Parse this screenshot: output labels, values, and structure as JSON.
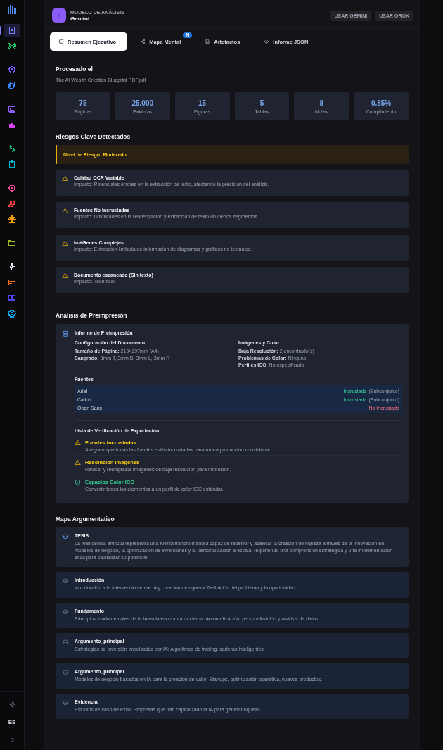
{
  "sidebar": {
    "items": [
      {
        "kind": "document",
        "color": "#7c83ff",
        "selected": true
      },
      {
        "kind": "signal",
        "color": "#22c55e",
        "selected": false
      },
      {
        "kind": "shield",
        "color": "#7c5cff",
        "selected": false
      },
      {
        "kind": "copy",
        "color": "#3b82f6",
        "selected": false
      },
      {
        "kind": "terminal",
        "color": "#8b5cf6",
        "selected": false
      },
      {
        "kind": "bars",
        "color": "#d946ef",
        "selected": false
      },
      {
        "kind": "translate",
        "color": "#10b981",
        "selected": false
      },
      {
        "kind": "clipboard",
        "color": "#06b6d4",
        "selected": false
      },
      {
        "kind": "cap",
        "color": "#ec4899",
        "selected": false
      },
      {
        "kind": "users",
        "color": "#ef4444",
        "selected": false
      },
      {
        "kind": "scales",
        "color": "#f59e0b",
        "selected": false
      },
      {
        "kind": "folder",
        "color": "#a3b818",
        "selected": false
      },
      {
        "kind": "person",
        "color": "#e5e7eb",
        "selected": false
      },
      {
        "kind": "card",
        "color": "#f97316",
        "selected": false
      },
      {
        "kind": "book",
        "color": "#4f46e5",
        "selected": false
      },
      {
        "kind": "gear",
        "color": "#0ea5e9",
        "selected": false
      }
    ],
    "language": "ES"
  },
  "header": {
    "caption": "MODELO DE ANÁLISIS",
    "model": "Gemini",
    "buttons": [
      "USAR GEMINI",
      "USAR GROK"
    ]
  },
  "tabs": [
    {
      "label": "Resumen Ejecutivo",
      "selected": true
    },
    {
      "label": "Mapa Mental",
      "badge": "N",
      "selected": false
    },
    {
      "label": "Artefactos",
      "selected": false
    },
    {
      "label": "Informe JSON",
      "selected": false
    }
  ],
  "processed": {
    "title": "Procesado el",
    "file": "The AI Wealth Creation Blueprint PDF.pdf"
  },
  "stats": [
    {
      "value": "75",
      "label": "Páginas"
    },
    {
      "value": "25.000",
      "label": "Palabras"
    },
    {
      "value": "15",
      "label": "Figuras"
    },
    {
      "value": "5",
      "label": "Tablas"
    },
    {
      "value": "8",
      "label": "Notas"
    },
    {
      "value": "0.85%",
      "label": "Cumplimiento"
    }
  ],
  "risks": {
    "title": "Riesgos Clave Detectados",
    "level": "Nivel de Riesgo: Moderado",
    "items": [
      {
        "title": "Calidad OCR Variable",
        "impact": "**Impacto:** Potenciales errores en la extracción de texto, afectando la precisión del análisis."
      },
      {
        "title": "Fuentes No Incrustadas",
        "impact": "**Impacto:** Dificultades en la renderización y extracción de texto en ciertos segmentos."
      },
      {
        "title": "ImáGenes Complejas",
        "impact": "**Impacto:** Extracción limitada de información de diagramas y gráficos no textuales."
      },
      {
        "title": "Documento escaneado (Sin texto)",
        "impact": "**Impacto:** Technical"
      }
    ]
  },
  "preprint": {
    "title": "Análisis de Preimpresión",
    "card_title": "Informe de Preimpresión",
    "columns": [
      {
        "title": "Configuración del Documento",
        "lines": [
          "**Tamaño de Página:** 210×297mm (A4)",
          "**Sangrado:** 3mm T, 3mm B, 3mm L, 3mm R"
        ]
      },
      {
        "title": "Imágenes y Color",
        "lines": [
          "**Baja Resolución:** 2 encontrado(s)",
          "**Problemas de Color:** Ninguno",
          "**Perfiles ICC:** No especificado"
        ]
      }
    ],
    "fonts_title": "Fuentes",
    "fonts": [
      {
        "name": "Arial",
        "status": "Incrustada",
        "note": "(Subconjunto)",
        "embedded": true
      },
      {
        "name": "Calibri",
        "status": "Incrustada",
        "note": "(Subconjunto)",
        "embedded": true
      },
      {
        "name": "Open Sans",
        "status": "No Incrustada",
        "embedded": false
      }
    ],
    "checklist_title": "Lista de Verificación de Exportación",
    "checklist": [
      {
        "kind": "warning",
        "title": "Fuentes Incrustadas",
        "text": "Asegurar que todas las fuentes estén incrustadas para una reproducción consistente."
      },
      {
        "kind": "warning",
        "title": "Resolucion Imagenes",
        "text": "Revisar y reemplazar imágenes de baja resolución para impresión."
      },
      {
        "kind": "ok",
        "title": "Espacios Color ICC",
        "text": "Convertir todos los elementos a un perfil de color ICC estándar."
      }
    ]
  },
  "argument_map": {
    "title": "Mapa Argumentativo",
    "items": [
      {
        "kind": "thesis",
        "title": "TESIS",
        "text": "La inteligencia artificial representa una fuerza transformadora capaz de redefinir y acelerar la creación de riqueza a través de la innovación en modelos de negocio, la optimización de inversiones y la personalización a escala, requiriendo una comprensión estratégica y una implementación ética para capitalizar su potencial."
      },
      {
        "kind": "node",
        "title": "Introducción",
        "text": "Introducción a la intersección entre IA y creación de riqueza: Definición del problema y la oportunidad."
      },
      {
        "kind": "node",
        "title": "Fundamento",
        "text": "Principios fundamentales de la IA en la economía moderna: Automatización, personalización y análisis de datos."
      },
      {
        "kind": "node",
        "title": "Argumento_principal",
        "text": "Estrategias de inversión impulsadas por IA: Algoritmos de trading, carteras inteligentes."
      },
      {
        "kind": "node",
        "title": "Argumento_principal",
        "text": "Modelos de negocio basados en IA para la creación de valor: Startups, optimización operativa, nuevos productos."
      },
      {
        "kind": "node",
        "title": "Evidencia",
        "text": "Estudios de caso de éxito: Empresas que han capitalizado la IA para generar riqueza."
      }
    ]
  }
}
